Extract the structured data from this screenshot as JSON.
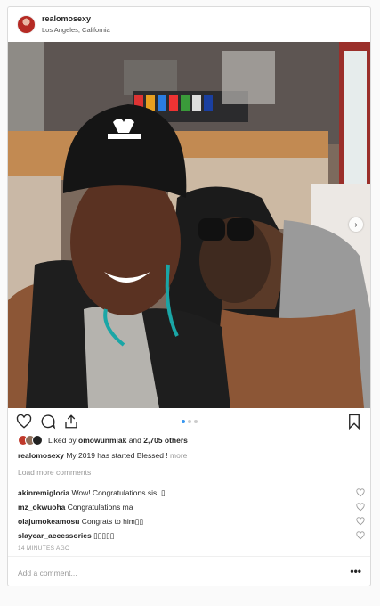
{
  "post": {
    "username": "realomosexy",
    "location": "Los Angeles, California"
  },
  "photo": {
    "slide_indicator": {
      "count": 3,
      "active": 1
    },
    "next_icon": "chevron-right-icon"
  },
  "actions": {
    "like_icon": "heart-icon",
    "comment_icon": "comment-icon",
    "share_icon": "share-icon",
    "save_icon": "bookmark-icon"
  },
  "likes": {
    "prefix": "Liked by ",
    "user": "omowunmiak",
    "middle": " and ",
    "count": "2,705 others"
  },
  "caption": {
    "user": "realomosexy",
    "text": " My 2019 has started Blessed ! ",
    "more": "more"
  },
  "load_more": "Load more comments",
  "comments": [
    {
      "user": "akinremigloria",
      "text": " Wow! Congratulations sis. ▯"
    },
    {
      "user": "mz_okwuoha",
      "text": " Congratulations ma"
    },
    {
      "user": "olajumokeamosu",
      "text": " Congrats to him▯▯"
    },
    {
      "user": "slaycar_accessories",
      "text": " ▯▯▯▯▯"
    }
  ],
  "time": "14 MINUTES AGO",
  "add_comment_placeholder": "Add a comment...",
  "options_label": "•••",
  "colors": {
    "accent": "#3897f0",
    "border": "#dbdbdb",
    "muted": "#999999"
  }
}
